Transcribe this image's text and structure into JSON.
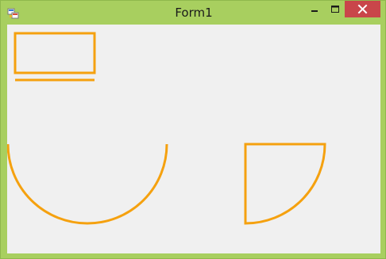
{
  "window": {
    "title": "Form1"
  },
  "icons": {
    "app": "form-app-icon",
    "minimize": "minimize-icon",
    "maximize": "maximize-icon",
    "close": "close-icon"
  },
  "colors": {
    "window_frame": "#a8cf5f",
    "client_background": "#f0f0f0",
    "shape_stroke": "#f5a10f",
    "close_button": "#c9464a"
  }
}
